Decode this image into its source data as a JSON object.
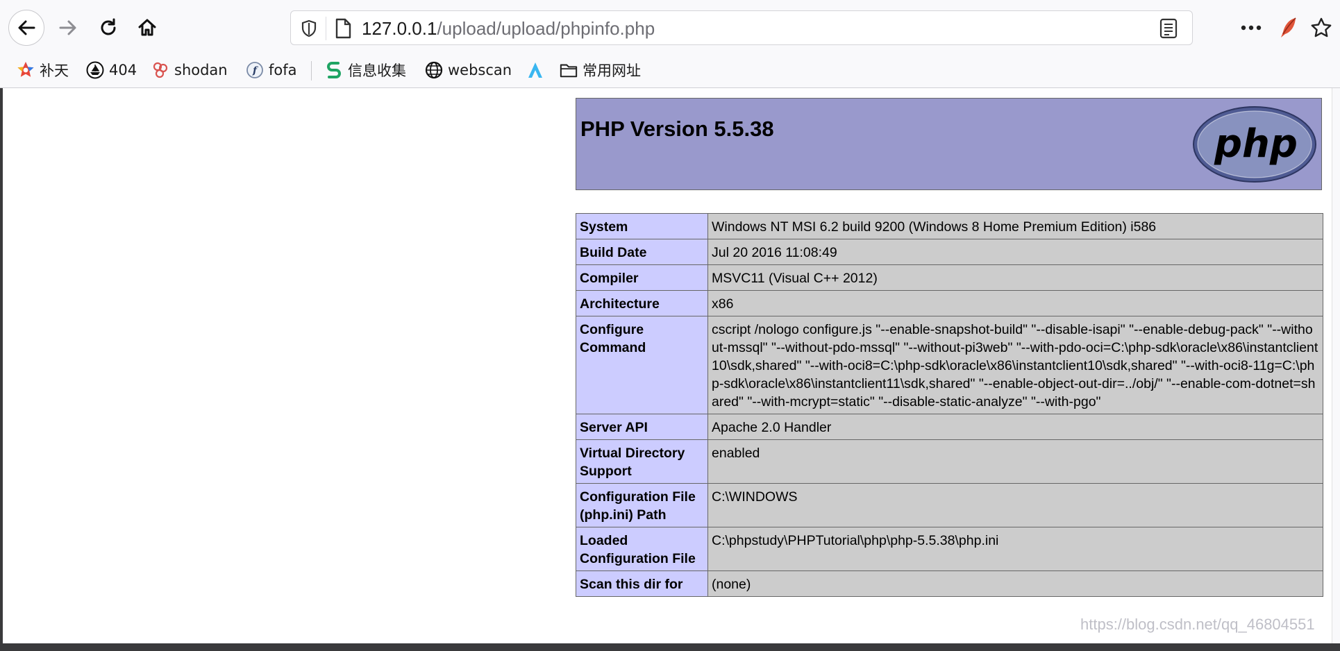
{
  "browser": {
    "url_host": "127.0.0.1",
    "url_path": "/upload/upload/phpinfo.php"
  },
  "bookmarks": [
    {
      "label": "补天",
      "icon": "colorful-star-icon"
    },
    {
      "label": "404",
      "icon": "ship-icon"
    },
    {
      "label": "shodan",
      "icon": "shodan-icon"
    },
    {
      "label": "fofa",
      "icon": "fofa-icon"
    },
    {
      "label": "信息收集",
      "icon": "green-s-icon"
    },
    {
      "label": "webscan",
      "icon": "globe-icon"
    },
    {
      "label": "",
      "icon": "blue-a-icon"
    },
    {
      "label": "常用网址",
      "icon": "folder-icon"
    }
  ],
  "php": {
    "title": "PHP Version 5.5.38",
    "logo_text": "php",
    "rows": [
      {
        "key": "System",
        "value": "Windows NT MSI 6.2 build 9200 (Windows 8 Home Premium Edition) i586"
      },
      {
        "key": "Build Date",
        "value": "Jul 20 2016 11:08:49"
      },
      {
        "key": "Compiler",
        "value": "MSVC11 (Visual C++ 2012)"
      },
      {
        "key": "Architecture",
        "value": "x86"
      },
      {
        "key": "Configure Command",
        "value": "cscript /nologo configure.js \"--enable-snapshot-build\" \"--disable-isapi\" \"--enable-debug-pack\" \"--without-mssql\" \"--without-pdo-mssql\" \"--without-pi3web\" \"--with-pdo-oci=C:\\php-sdk\\oracle\\x86\\instantclient10\\sdk,shared\" \"--with-oci8=C:\\php-sdk\\oracle\\x86\\instantclient10\\sdk,shared\" \"--with-oci8-11g=C:\\php-sdk\\oracle\\x86\\instantclient11\\sdk,shared\" \"--enable-object-out-dir=../obj/\" \"--enable-com-dotnet=shared\" \"--with-mcrypt=static\" \"--disable-static-analyze\" \"--with-pgo\""
      },
      {
        "key": "Server API",
        "value": "Apache 2.0 Handler"
      },
      {
        "key": "Virtual Directory Support",
        "value": "enabled"
      },
      {
        "key": "Configuration File (php.ini) Path",
        "value": "C:\\WINDOWS"
      },
      {
        "key": "Loaded Configuration File",
        "value": "C:\\phpstudy\\PHPTutorial\\php\\php-5.5.38\\php.ini"
      },
      {
        "key": "Scan this dir for",
        "value": "(none)"
      }
    ]
  },
  "watermark": "https://blog.csdn.net/qq_46804551"
}
